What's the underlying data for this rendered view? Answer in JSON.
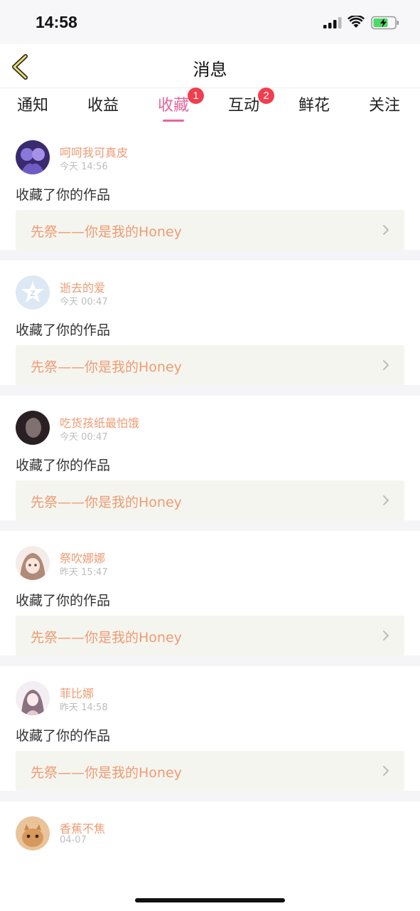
{
  "status_bar": {
    "time": "14:58"
  },
  "header": {
    "title": "消息",
    "back_icon": "chevron-left-icon"
  },
  "tabs": [
    {
      "label": "通知"
    },
    {
      "label": "收益"
    },
    {
      "label": "收藏",
      "badge": "1",
      "active": true
    },
    {
      "label": "互动",
      "badge": "2"
    },
    {
      "label": "鲜花"
    },
    {
      "label": "关注"
    }
  ],
  "colors": {
    "accent": "#e6669d",
    "badge": "#f03e4e",
    "username": "#ee9b73",
    "link_bg": "#f5f5ef",
    "separator": "#f5f4f7"
  },
  "items": [
    {
      "user": "呵呵我可真皮",
      "time": "今天 14:56",
      "action": "收藏了你的作品",
      "work": "先祭——你是我的Honey"
    },
    {
      "user": "逝去的爱",
      "time": "今天 00:47",
      "action": "收藏了你的作品",
      "work": "先祭——你是我的Honey"
    },
    {
      "user": "吃货孩纸最怕饿",
      "time": "今天 00:47",
      "action": "收藏了你的作品",
      "work": "先祭——你是我的Honey"
    },
    {
      "user": "祭吹娜娜",
      "time": "昨天 15:47",
      "action": "收藏了你的作品",
      "work": "先祭——你是我的Honey"
    },
    {
      "user": "菲比娜",
      "time": "昨天 14:58",
      "action": "收藏了你的作品",
      "work": "先祭——你是我的Honey"
    },
    {
      "user": "香蕉不焦",
      "time": "04-07"
    }
  ]
}
